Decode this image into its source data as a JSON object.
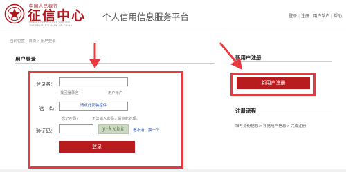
{
  "header": {
    "logo_top_text": "中国人民银行",
    "logo_main": "征信中心",
    "logo_en_line1": "CREDIT REFERENCE CENTER",
    "logo_en_line2": "THE PEOPLE'S BANK OF CHINA",
    "site_title": "个人信用信息服务平台",
    "links": [
      "登录",
      "注册",
      "用户帮户",
      "帮助"
    ]
  },
  "breadcrumb": "当前位置：首页 > 用户登录",
  "login": {
    "title": "用户登录",
    "username_label": "登录名：",
    "find_login_name": "找回登录名",
    "user_account": "用户帐户",
    "password_label": "密　码：",
    "password_placeholder": "请点此安装控件",
    "forgot_password": "忘记密码？",
    "cannot_input": "无法输入密码，请点此处理。",
    "captcha_label": "验证码：",
    "captcha_text": "y-kxhk",
    "captcha_refresh": "看不清，换一个",
    "submit_label": "登录"
  },
  "register": {
    "title": "新用户注册",
    "button_label": "新用户注册",
    "flow_title": "注册流程",
    "flow_text": "填写身份信息 > 补充用户信息 > 完成注册"
  },
  "colors": {
    "brand_red": "#b81c1f",
    "highlight_red": "#e8393f",
    "link_blue": "#2a5cb8"
  }
}
